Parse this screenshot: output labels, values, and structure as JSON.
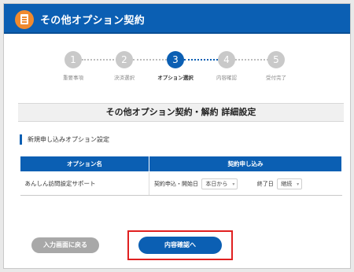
{
  "header": {
    "title": "その他オプション契約"
  },
  "steps": [
    {
      "num": "1",
      "label": "重要事項",
      "active": false
    },
    {
      "num": "2",
      "label": "決済選択",
      "active": false
    },
    {
      "num": "3",
      "label": "オプション選択",
      "active": true
    },
    {
      "num": "4",
      "label": "内容確認",
      "active": false
    },
    {
      "num": "5",
      "label": "受付完了",
      "active": false
    }
  ],
  "section": {
    "title": "その他オプション契約・解約 詳細設定"
  },
  "subsection": {
    "title": "新規申し込みオプション設定"
  },
  "table": {
    "headers": [
      "オプション名",
      "契約申し込み"
    ],
    "row": {
      "option_name": "あんしん訪問設定サポート",
      "start_label": "契約申込・開始日",
      "start_value": "本日から",
      "end_label": "終了日",
      "end_value": "継続"
    }
  },
  "buttons": {
    "back": "入力画面に戻る",
    "confirm": "内容確認へ"
  },
  "colors": {
    "primary": "#0b5fb3",
    "accent": "#f08a2e",
    "highlight": "#e02020"
  }
}
